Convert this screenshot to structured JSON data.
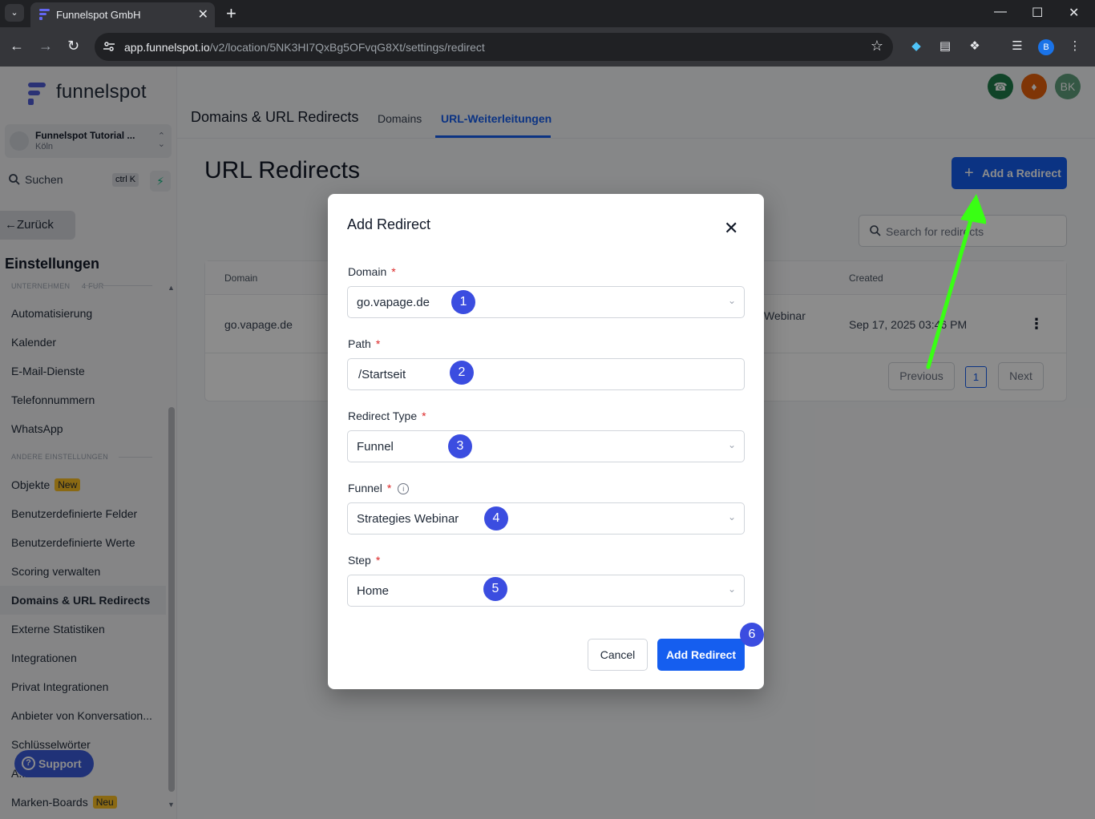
{
  "browser": {
    "tab_title": "Funnelspot GmbH",
    "url_host": "app.funnelspot.io",
    "url_path": "/v2/location/5NK3HI7QxBg5OFvqG8Xt/settings/redirect",
    "profile_initial": "B"
  },
  "sidebar": {
    "logo_text": "funnelspot",
    "location_name": "Funnelspot Tutorial ...",
    "location_city": "Köln",
    "search_label": "Suchen",
    "search_shortcut": "ctrl K",
    "back_label": "Zurück",
    "settings_heading": "Einstellungen",
    "section_business": "UNTERNEHMEN",
    "section_business_extra": "4 FUR",
    "section_other": "ANDERE EINSTELLUNGEN",
    "items_top": [
      "Automatisierung",
      "Kalender",
      "E-Mail-Dienste",
      "Telefonnummern",
      "WhatsApp"
    ],
    "items_other": [
      {
        "label": "Objekte",
        "badge": "New"
      },
      {
        "label": "Benutzerdefinierte Felder"
      },
      {
        "label": "Benutzerdefinierte Werte"
      },
      {
        "label": "Scoring verwalten"
      },
      {
        "label": "Domains & URL Redirects",
        "active": true
      },
      {
        "label": "Externe Statistiken"
      },
      {
        "label": "Integrationen"
      },
      {
        "label": "Privat Integrationen"
      },
      {
        "label": "Anbieter von Konversation..."
      },
      {
        "label": "Schlüsselwörter"
      },
      {
        "label": "A...e:"
      },
      {
        "label": "Marken-Boards",
        "badge": "Neu"
      }
    ],
    "support_label": "Support"
  },
  "header": {
    "page_heading": "Domains & URL Redirects",
    "tabs": [
      {
        "label": "Domains",
        "active": false
      },
      {
        "label": "URL-Weiterleitungen",
        "active": true
      }
    ],
    "avatar_initials": "BK",
    "colors": {
      "phone": "#1e7d4a",
      "bell": "#e8620c",
      "avatar": "#5f9e7c"
    }
  },
  "main": {
    "title": "URL Redirects",
    "add_button": "Add a Redirect",
    "search_placeholder": "Search for redirects",
    "columns": {
      "domain": "Domain",
      "created": "Created"
    },
    "row": {
      "domain": "go.vapage.de",
      "target_fragment": "Webinar",
      "created": "Sep 17, 2025 03:46 PM"
    },
    "pagination": {
      "previous": "Previous",
      "page": "1",
      "next": "Next"
    }
  },
  "modal": {
    "title": "Add Redirect",
    "fields": [
      {
        "label": "Domain",
        "value": "go.vapage.de",
        "type": "select",
        "step": "1"
      },
      {
        "label": "Path",
        "value": "/Startseit",
        "type": "text",
        "step": "2"
      },
      {
        "label": "Redirect Type",
        "value": "Funnel",
        "type": "select",
        "step": "3"
      },
      {
        "label": "Funnel",
        "value": "Strategies Webinar",
        "type": "select",
        "step": "4"
      },
      {
        "label": "Step",
        "value": "Home",
        "type": "select",
        "step": "5"
      }
    ],
    "required_mark": "*",
    "cancel_label": "Cancel",
    "submit_label": "Add Redirect",
    "submit_step": "6"
  },
  "colors": {
    "accent": "#155eef",
    "step_badge": "#3b4de0",
    "annotation_arrow": "#39ff14"
  }
}
